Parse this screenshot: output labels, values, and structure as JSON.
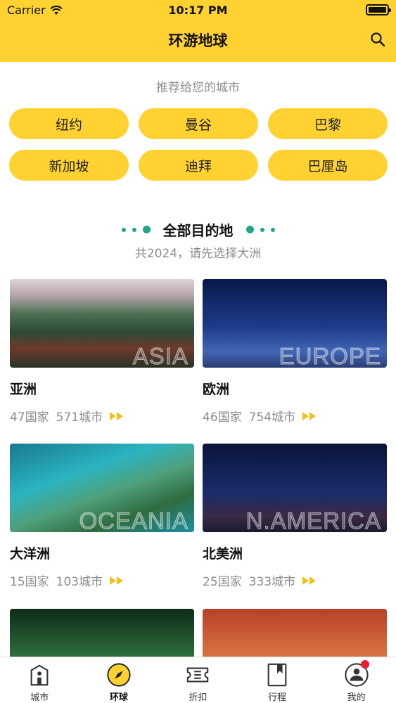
{
  "status_bar": {
    "carrier": "Carrier",
    "time": "10:17 PM"
  },
  "nav": {
    "title": "环游地球",
    "search_icon": "search-icon"
  },
  "recommended": {
    "label": "推荐给您的城市",
    "cities": [
      "纽约",
      "曼谷",
      "巴黎",
      "新加坡",
      "迪拜",
      "巴厘岛"
    ]
  },
  "destinations": {
    "title": "全部目的地",
    "subtitle": "共2024，请先选择大洲",
    "continents": [
      {
        "name": "亚洲",
        "watermark": "ASIA",
        "countries": "47国家",
        "cities": "571城市"
      },
      {
        "name": "欧洲",
        "watermark": "EUROPE",
        "countries": "46国家",
        "cities": "754城市"
      },
      {
        "name": "大洋洲",
        "watermark": "OCEANIA",
        "countries": "15国家",
        "cities": "103城市"
      },
      {
        "name": "北美洲",
        "watermark": "N.AMERICA",
        "countries": "25国家",
        "cities": "333城市"
      }
    ]
  },
  "tabbar": {
    "tabs": [
      {
        "label": "城市",
        "icon": "building-icon"
      },
      {
        "label": "环球",
        "icon": "compass-icon",
        "active": true
      },
      {
        "label": "折扣",
        "icon": "ticket-icon"
      },
      {
        "label": "行程",
        "icon": "bookmark-icon"
      },
      {
        "label": "我的",
        "icon": "profile-icon",
        "badge": true
      }
    ]
  },
  "colors": {
    "accent": "#ffd231",
    "teal": "#1fa58a",
    "badge": "#ee1c2e"
  }
}
